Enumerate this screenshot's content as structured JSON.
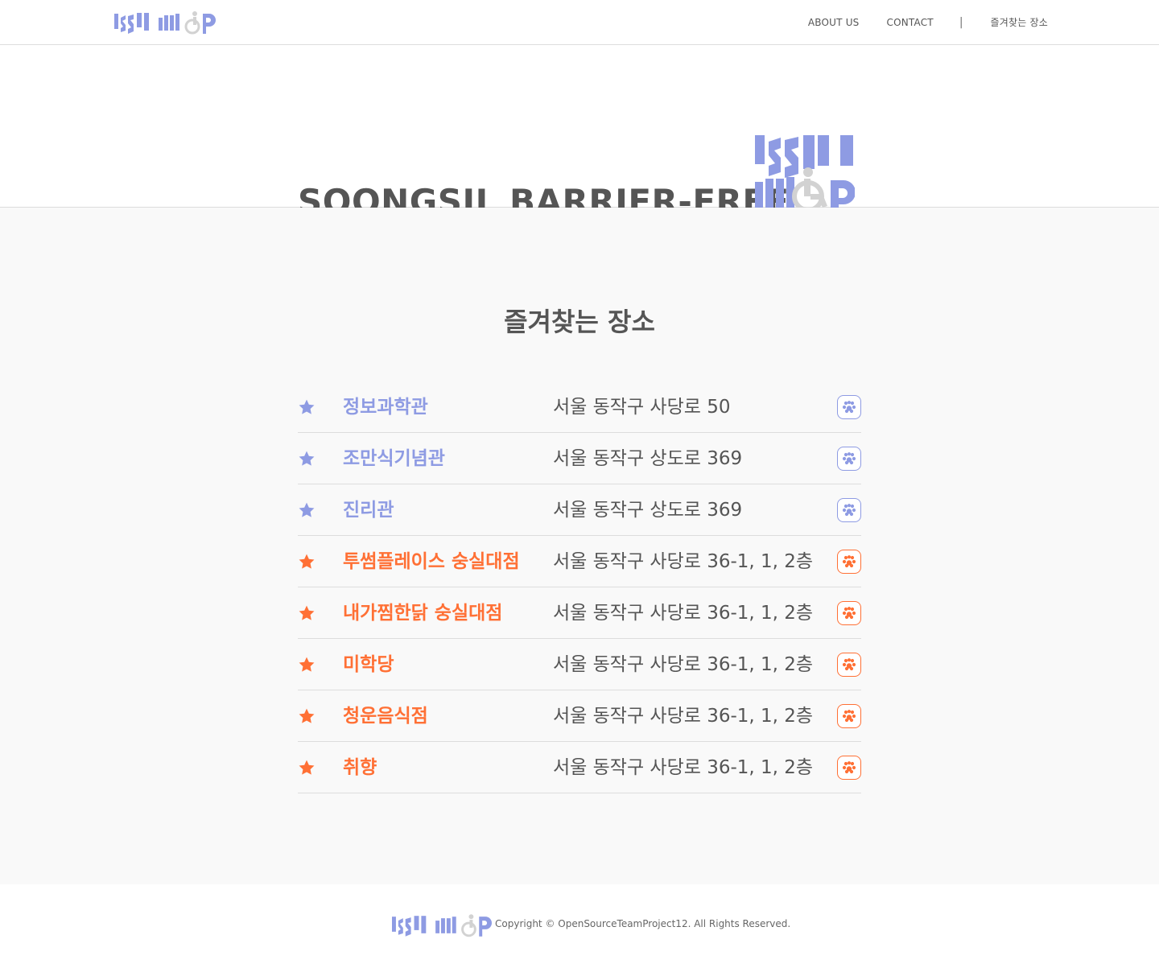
{
  "brand": {
    "logo_icon": "ssumap-logo",
    "accent_color": "#8e9be3",
    "secondary_color": "#ff7035",
    "wheelchair_color": "#d2d2d2"
  },
  "header": {
    "nav": {
      "about": "ABOUT US",
      "contact": "CONTACT",
      "separator": "|",
      "favorites": "즐겨찾는 장소"
    }
  },
  "hero": {
    "title": "SOONGSIL BARRIER-FREE"
  },
  "main": {
    "title": "즐겨찾는 장소",
    "favorites": [
      {
        "name": "정보과학관",
        "address": "서울 동작구 사당로 50",
        "type": "building",
        "icon": "star-icon"
      },
      {
        "name": "조만식기념관",
        "address": "서울 동작구 상도로 369",
        "type": "building",
        "icon": "star-icon"
      },
      {
        "name": "진리관",
        "address": "서울 동작구 상도로 369",
        "type": "building",
        "icon": "star-icon"
      },
      {
        "name": "투썸플레이스 숭실대점",
        "address": "서울 동작구 사당로 36-1, 1, 2층",
        "type": "restaurant",
        "icon": "star-icon"
      },
      {
        "name": "내가찜한닭 숭실대점",
        "address": "서울 동작구 사당로 36-1, 1, 2층",
        "type": "restaurant",
        "icon": "star-icon"
      },
      {
        "name": "미학당",
        "address": "서울 동작구 사당로 36-1, 1, 2층",
        "type": "restaurant",
        "icon": "star-icon"
      },
      {
        "name": "청운음식점",
        "address": "서울 동작구 사당로 36-1, 1, 2층",
        "type": "restaurant",
        "icon": "star-icon"
      },
      {
        "name": "취향",
        "address": "서울 동작구 사당로 36-1, 1, 2층",
        "type": "restaurant",
        "icon": "star-icon"
      }
    ]
  },
  "footer": {
    "copyright": "Copyright © OpenSourceTeamProject12. All Rights Reserved."
  }
}
